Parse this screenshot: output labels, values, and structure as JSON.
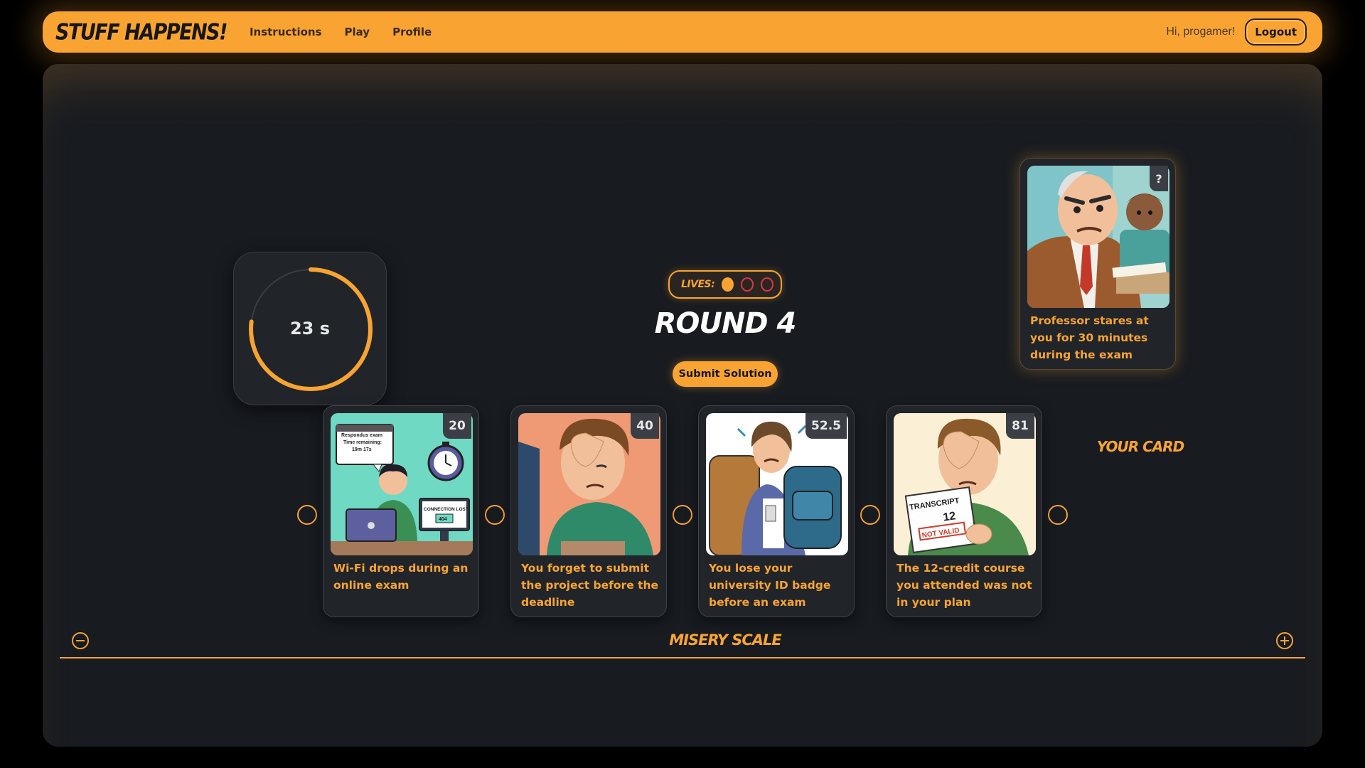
{
  "navbar": {
    "brand": "STUFF HAPPENS!",
    "links": [
      "Instructions",
      "Play",
      "Profile"
    ],
    "greeting": "Hi, progamer!",
    "logout_label": "Logout"
  },
  "timer": {
    "text": "23 s",
    "remaining_fraction": 0.77
  },
  "lives": {
    "label": "LIVES:",
    "total": 3,
    "remaining": 1
  },
  "round": {
    "title": "ROUND 4",
    "submit_label": "Submit Solution"
  },
  "your_card": {
    "label": "YOUR CARD",
    "badge": "?",
    "description": "Professor stares at you for 30 minutes during the exam",
    "icon": "angry-professor-illustration"
  },
  "timeline_cards": [
    {
      "badge": "20",
      "description": "Wi-Fi drops during an online exam",
      "icon": "wifi-drop-illustration",
      "art_text": [
        "Respondus exam",
        "Time remaining:",
        "19m 17s",
        "CONNECTION LOST",
        "404"
      ]
    },
    {
      "badge": "40",
      "description": "You forget to submit the project before the deadline",
      "icon": "facepalm-illustration"
    },
    {
      "badge": "52.5",
      "description": "You lose your university ID badge before an exam",
      "icon": "lost-badge-illustration"
    },
    {
      "badge": "81",
      "description": "The 12-credit course you attended was not in your plan",
      "icon": "transcript-illustration",
      "art_text": [
        "TRANSCRIPT",
        "12",
        "NOT VALID"
      ]
    }
  ],
  "scale": {
    "label": "MISERY SCALE"
  },
  "colors": {
    "accent": "#f9a432",
    "panel": "#181b20",
    "card": "#21252a",
    "lost_life": "#d9364a"
  }
}
